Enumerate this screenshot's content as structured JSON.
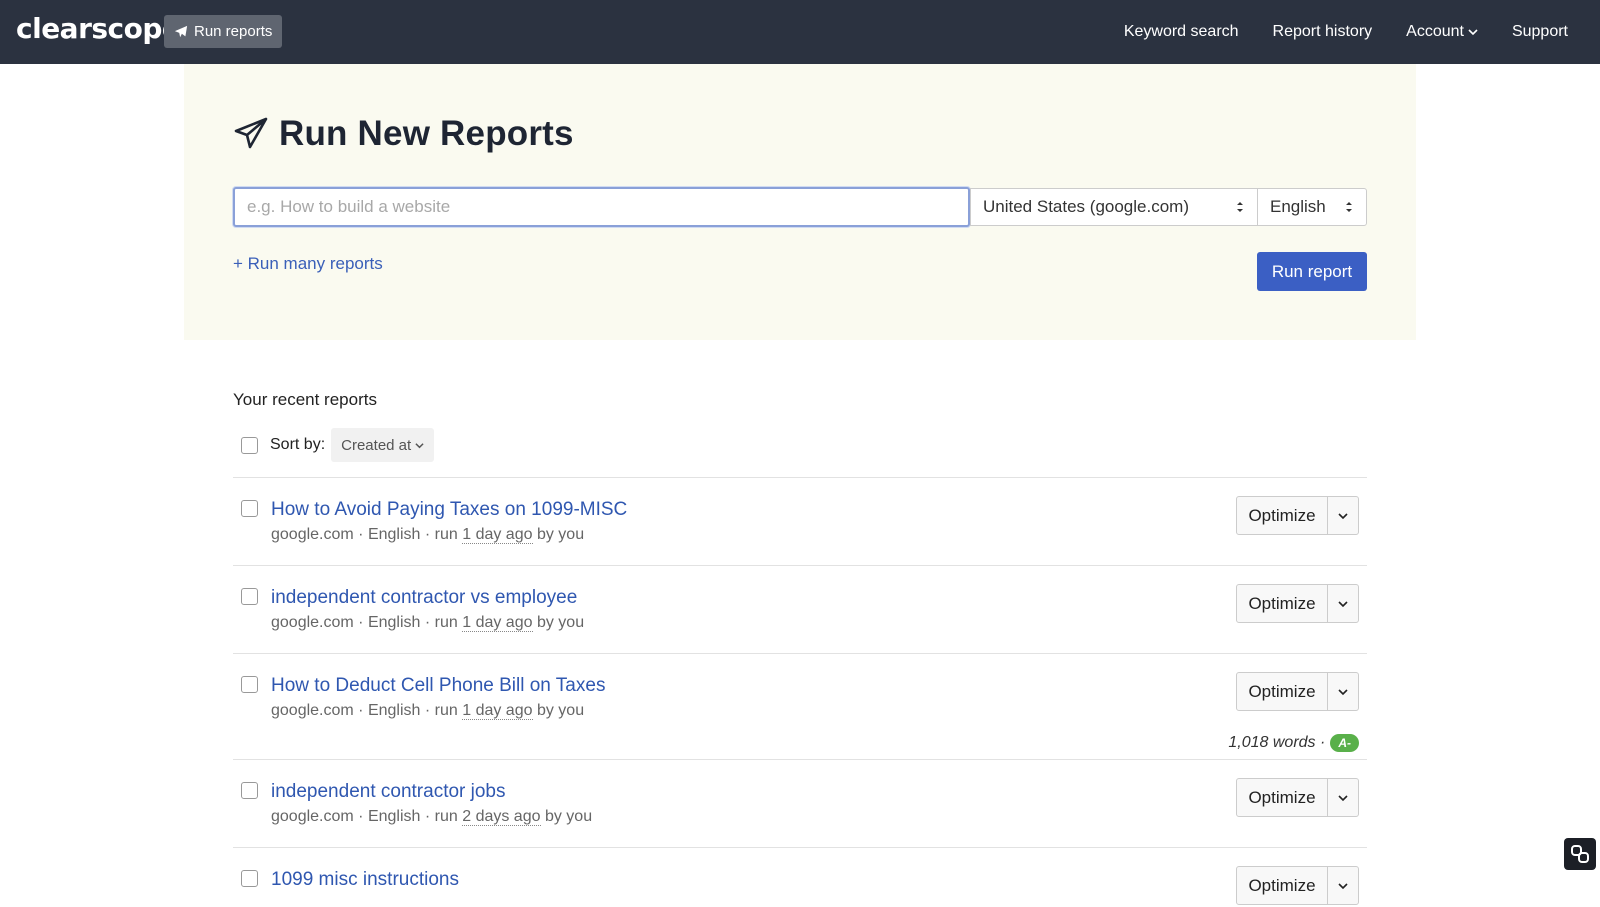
{
  "header": {
    "logo": "clearscope",
    "run_reports": "Run reports",
    "nav": [
      {
        "label": "Keyword search"
      },
      {
        "label": "Report history"
      },
      {
        "label": "Account"
      },
      {
        "label": "Support"
      }
    ]
  },
  "hero": {
    "title": "Run New Reports",
    "search_placeholder": "e.g. How to build a website",
    "country": "United States (google.com)",
    "language": "English",
    "run_many": "+ Run many reports",
    "run_report": "Run report"
  },
  "recent": {
    "title": "Your recent reports",
    "sort_label": "Sort by:",
    "sort_value": "Created at",
    "optimize_label": "Optimize",
    "items": [
      {
        "title": "How to Avoid Paying Taxes on 1099-MISC",
        "meta_pre": "google.com · English · run",
        "ago": "1 day ago",
        "meta_post": "by you"
      },
      {
        "title": "independent contractor vs employee",
        "meta_pre": "google.com · English · run",
        "ago": "1 day ago",
        "meta_post": "by you"
      },
      {
        "title": "How to Deduct Cell Phone Bill on Taxes",
        "meta_pre": "google.com · English · run",
        "ago": "1 day ago",
        "meta_post": "by you",
        "words": "1,018 words ·",
        "grade": "A-"
      },
      {
        "title": "independent contractor jobs",
        "meta_pre": "google.com · English · run",
        "ago": "2 days ago",
        "meta_post": "by you"
      },
      {
        "title": "1099 misc instructions",
        "meta_pre": "",
        "ago": "",
        "meta_post": ""
      }
    ]
  },
  "colors": {
    "nav_bg": "#2b3240",
    "accent": "#3b5fc4",
    "link": "#2f57b0",
    "hero_bg": "#fafaf0",
    "grade": "#59b04a"
  }
}
